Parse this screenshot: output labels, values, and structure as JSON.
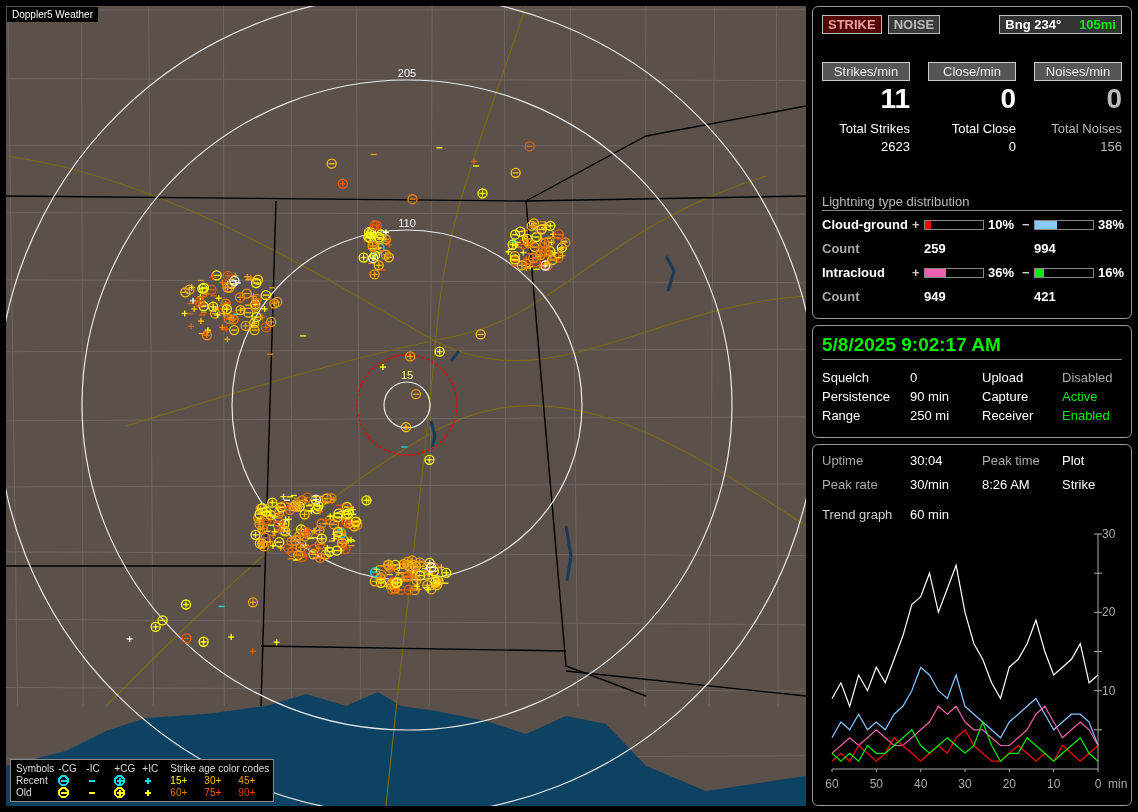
{
  "window": {
    "title": "Doppler5 Weather"
  },
  "map": {
    "range_labels": [
      "205",
      "110",
      "15"
    ]
  },
  "legend": {
    "header": "Symbols",
    "age_header": "Strike age color codes",
    "columns": [
      {
        "label": "-CG",
        "kind": "minus-circle"
      },
      {
        "label": "-IC",
        "kind": "dash"
      },
      {
        "label": "+CG",
        "kind": "plus-circle"
      },
      {
        "label": "+IC",
        "kind": "plus"
      }
    ],
    "rows": [
      {
        "label": "Recent",
        "color": "#00e0f0",
        "ages": [
          {
            "text": "15+",
            "color": "#ffff00"
          },
          {
            "text": "30+",
            "color": "#ffc000"
          },
          {
            "text": "45+",
            "color": "#e8a000"
          }
        ]
      },
      {
        "label": "Old",
        "color": "#ffff00",
        "ages": [
          {
            "text": "60+",
            "color": "#e07800"
          },
          {
            "text": "75+",
            "color": "#f06000"
          },
          {
            "text": "90+",
            "color": "#e84000"
          }
        ]
      }
    ]
  },
  "modes": [
    {
      "label": "STRIKE",
      "selected": true
    },
    {
      "label": "NOISE",
      "selected": false
    }
  ],
  "bearing": {
    "label": "Bng 234°",
    "distance": "105mi"
  },
  "rates": [
    {
      "label": "Strikes/min",
      "value": "11",
      "total_label": "Total Strikes",
      "total": "2623",
      "muted": false
    },
    {
      "label": "Close/min",
      "value": "0",
      "total_label": "Total Close",
      "total": "0",
      "muted": false
    },
    {
      "label": "Noises/min",
      "value": "0",
      "total_label": "Total Noises",
      "total": "156",
      "muted": true
    }
  ],
  "distribution": {
    "title": "Lightning type distribution",
    "rows": [
      {
        "name": "Cloud-ground",
        "count_label": "Count",
        "pos": {
          "sign": "+",
          "level": 0.1,
          "text": "10%",
          "color": "#ff0000",
          "count": "259"
        },
        "neg": {
          "sign": "−",
          "level": 0.38,
          "text": "38%",
          "color": "#88c8ff",
          "count": "994"
        }
      },
      {
        "name": "Intracloud",
        "count_label": "Count",
        "pos": {
          "sign": "+",
          "level": 0.36,
          "text": "36%",
          "color": "#f060b0",
          "count": "949"
        },
        "neg": {
          "sign": "−",
          "level": 0.16,
          "text": "16%",
          "color": "#00ee00",
          "count": "421"
        }
      }
    ]
  },
  "clock": "5/8/2025 9:02:17 AM",
  "settings": [
    {
      "label": "Squelch",
      "value": "0",
      "status_label": "Upload",
      "status": "Disabled",
      "on": false
    },
    {
      "label": "Persistence",
      "value": "90 min",
      "status_label": "Capture",
      "status": "Active",
      "on": true
    },
    {
      "label": "Range",
      "value": "250 mi",
      "status_label": "Receiver",
      "status": "Enabled",
      "on": true
    }
  ],
  "stats": [
    [
      {
        "kind": "label",
        "text": "Uptime"
      },
      {
        "kind": "value",
        "text": "30:04"
      },
      {
        "kind": "label",
        "text": "Peak time"
      },
      {
        "kind": "value",
        "text": "Plot"
      }
    ],
    [
      {
        "kind": "label",
        "text": "Peak rate"
      },
      {
        "kind": "value",
        "text": "30/min"
      },
      {
        "kind": "value",
        "text": "8:26 AM"
      },
      {
        "kind": "value",
        "text": "Strike"
      }
    ]
  ],
  "trend": {
    "label": "Trend graph",
    "value": "60 min",
    "chart_data": {
      "type": "line",
      "xlabel": "min",
      "x": [
        60,
        58,
        56,
        54,
        52,
        50,
        48,
        46,
        44,
        42,
        40,
        38,
        36,
        34,
        32,
        30,
        28,
        26,
        24,
        22,
        20,
        18,
        16,
        14,
        12,
        10,
        8,
        6,
        4,
        2,
        0
      ],
      "xlim": [
        60,
        0
      ],
      "ylim": [
        0,
        30
      ],
      "xticks": [
        60,
        50,
        40,
        30,
        20,
        10,
        0
      ],
      "yticks": [
        10,
        20,
        30
      ],
      "series": [
        {
          "color": "#ffffff",
          "values": [
            9,
            11,
            8,
            12,
            10,
            13,
            11,
            14,
            17,
            21,
            22,
            25,
            20,
            23,
            26,
            20,
            16,
            14,
            11,
            9,
            13,
            14,
            16,
            19,
            15,
            12,
            13,
            14,
            16,
            11,
            12
          ]
        },
        {
          "color": "#88c8ff",
          "values": [
            4,
            6,
            5,
            7,
            5,
            6,
            5,
            7,
            8,
            10,
            13,
            12,
            10,
            9,
            12,
            8,
            7,
            6,
            5,
            4,
            6,
            7,
            8,
            9,
            7,
            5,
            6,
            7,
            7,
            6,
            3
          ]
        },
        {
          "color": "#f060b0",
          "values": [
            2,
            3,
            4,
            3,
            4,
            5,
            4,
            3,
            3,
            4,
            5,
            6,
            8,
            7,
            8,
            6,
            5,
            5,
            4,
            3,
            3,
            4,
            5,
            7,
            8,
            6,
            4,
            5,
            6,
            5,
            3
          ]
        },
        {
          "color": "#ff0000",
          "values": [
            1,
            2,
            1,
            3,
            2,
            1,
            2,
            4,
            3,
            2,
            1,
            2,
            3,
            2,
            4,
            5,
            3,
            2,
            1,
            1,
            2,
            3,
            2,
            1,
            2,
            1,
            3,
            2,
            1,
            2,
            3
          ]
        },
        {
          "color": "#00ee00",
          "values": [
            2,
            1,
            2,
            1,
            3,
            2,
            2,
            3,
            4,
            5,
            3,
            2,
            3,
            4,
            3,
            2,
            3,
            6,
            3,
            1,
            2,
            2,
            4,
            3,
            2,
            1,
            2,
            3,
            4,
            2,
            1
          ]
        }
      ]
    }
  }
}
